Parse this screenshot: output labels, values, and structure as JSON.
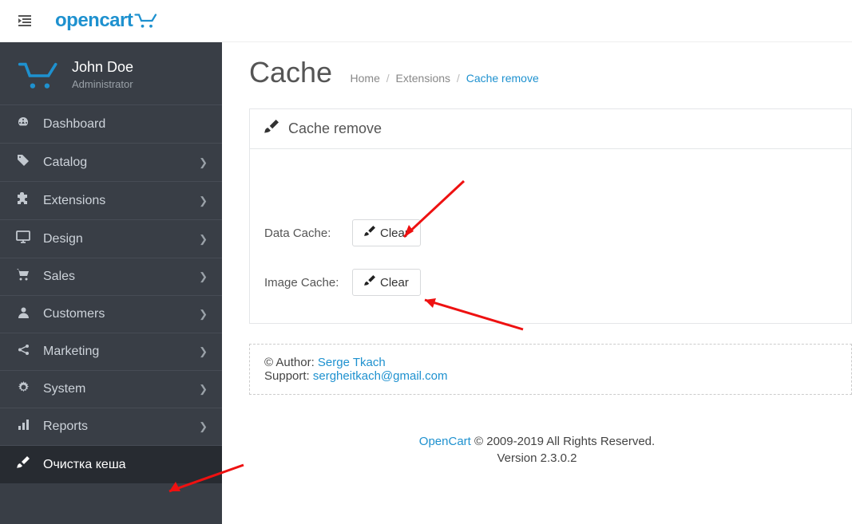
{
  "header": {
    "logo_open": "open",
    "logo_cart": "cart"
  },
  "profile": {
    "name": "John Doe",
    "role": "Administrator"
  },
  "sidebar": {
    "items": [
      {
        "label": "Dashboard",
        "expandable": false
      },
      {
        "label": "Catalog",
        "expandable": true
      },
      {
        "label": "Extensions",
        "expandable": true
      },
      {
        "label": "Design",
        "expandable": true
      },
      {
        "label": "Sales",
        "expandable": true
      },
      {
        "label": "Customers",
        "expandable": true
      },
      {
        "label": "Marketing",
        "expandable": true
      },
      {
        "label": "System",
        "expandable": true
      },
      {
        "label": "Reports",
        "expandable": true
      },
      {
        "label": "Очистка кеша",
        "expandable": false
      }
    ]
  },
  "page": {
    "title": "Cache",
    "breadcrumbs": {
      "home": "Home",
      "ext": "Extensions",
      "current": "Cache remove"
    },
    "panel_title": "Cache remove",
    "rows": [
      {
        "label": "Data Cache:",
        "button": "Clear"
      },
      {
        "label": "Image Cache:",
        "button": "Clear"
      }
    ],
    "author_prefix": "© Author: ",
    "author_link": "Serge Tkach",
    "support_prefix": "Support: ",
    "support_link": "sergheitkach@gmail.com",
    "footer_brand": "OpenCart",
    "footer_rights": " © 2009-2019 All Rights Reserved.",
    "footer_version": "Version 2.3.0.2"
  }
}
